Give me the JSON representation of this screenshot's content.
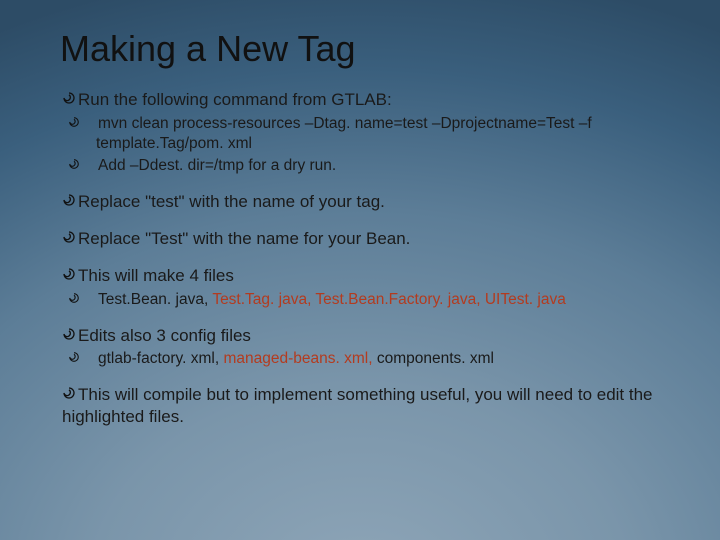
{
  "title": "Making a New Tag",
  "bullets": {
    "b1": "Run the following command from GTLAB:",
    "b1a": "mvn clean process-resources –Dtag. name=test –Dprojectname=Test –f template.Tag/pom. xml",
    "b1b": "Add –Ddest. dir=/tmp for a dry run.",
    "b2": "Replace \"test\" with the name of your tag.",
    "b3": "Replace \"Test\" with the name for your Bean.",
    "b4": "This will make 4 files",
    "b4a_pre": "Test.Bean. java, ",
    "b4a_hl": "Test.Tag. java, Test.Bean.Factory. java, UITest. java",
    "b5": "Edits also 3 config files",
    "b5a_pre": "gtlab-factory. xml, ",
    "b5a_hl": "managed-beans. xml,",
    "b5a_post": "  components. xml",
    "b6": "This will compile but to implement something useful, you will need to edit the highlighted files."
  },
  "glyph": "curl"
}
